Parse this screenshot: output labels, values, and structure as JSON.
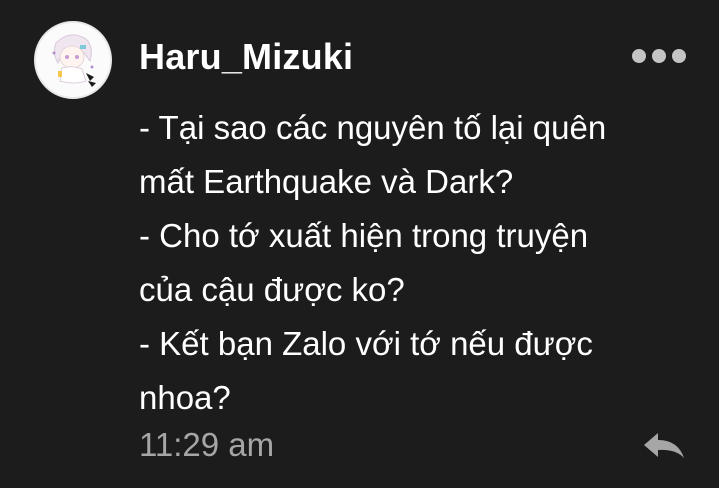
{
  "comment": {
    "username": "Haru_Mizuki",
    "avatar_icon": "anime-character-avatar",
    "more_icon": "more-options-icon",
    "message_lines": [
      "- Tại sao các nguyên tố lại quên",
      "mất Earthquake và Dark?",
      "- Cho tớ xuất hiện trong truyện",
      "của cậu được ko?",
      "- Kết bạn Zalo với tớ nếu được",
      "nhoa?"
    ],
    "timestamp": "11:29 am",
    "reply_icon": "reply-icon"
  },
  "colors": {
    "background": "#1c1c1c",
    "text": "#ffffff",
    "muted": "#a6a6a6",
    "icon": "#c4c4c4"
  }
}
